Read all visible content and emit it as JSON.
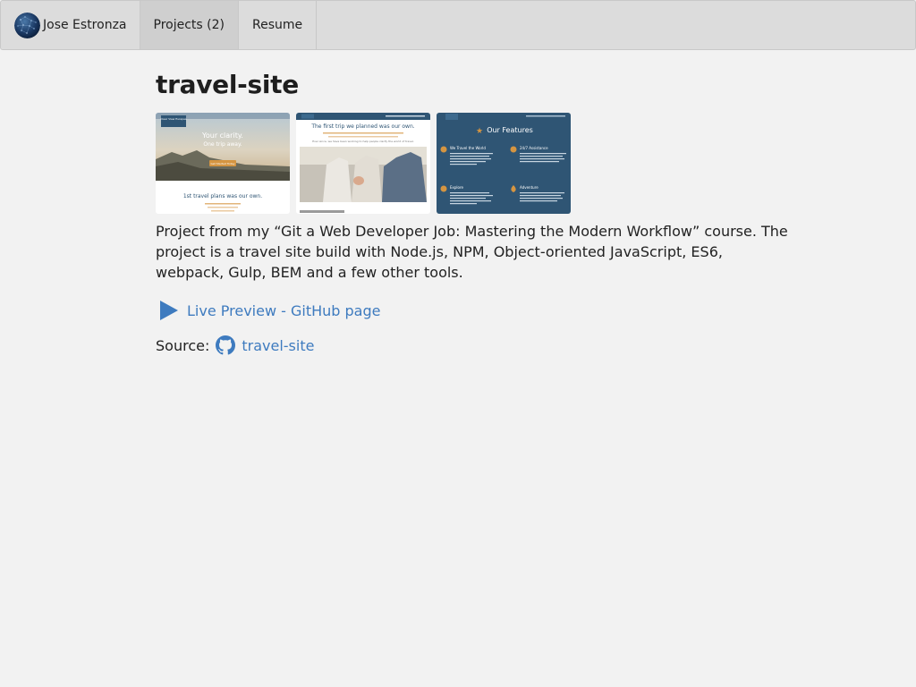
{
  "nav": {
    "brand": "Jose Estronza",
    "items": [
      {
        "label": "Projects (2)",
        "active": true
      },
      {
        "label": "Resume",
        "active": false
      }
    ]
  },
  "project": {
    "title": "travel-site",
    "description": "Project from my “Git a Web Developer Job: Mastering the Modern Workflow” course. The project is a travel site build with Node.js, NPM, Object-oriented JavaScript, ES6, webpack, Gulp, BEM and a few other tools.",
    "preview_label": "Live Preview - GitHub page",
    "source_label": "Source:",
    "source_link": "travel-site",
    "screenshots": [
      {
        "logo": "Clear View Escapes",
        "headline": "Your clarity.",
        "subline": "One trip away.",
        "button": "Get Started Today",
        "footer": "1st travel plans was our own."
      },
      {
        "headline": "The first trip we planned was our own.",
        "caption": "Ever since, we have been working to help people clarify the world of travel."
      },
      {
        "logo": "Clear View Escapes",
        "heading": "Our Features",
        "features": [
          "We Travel the World",
          "24/7 Assistance",
          "Explore",
          "Adventure"
        ]
      }
    ]
  },
  "colors": {
    "background": "#f2f2f2",
    "navbar": "#dcdcdc",
    "link": "#3e7bbf",
    "features_bg": "#2f5574",
    "accent": "#d59541"
  }
}
